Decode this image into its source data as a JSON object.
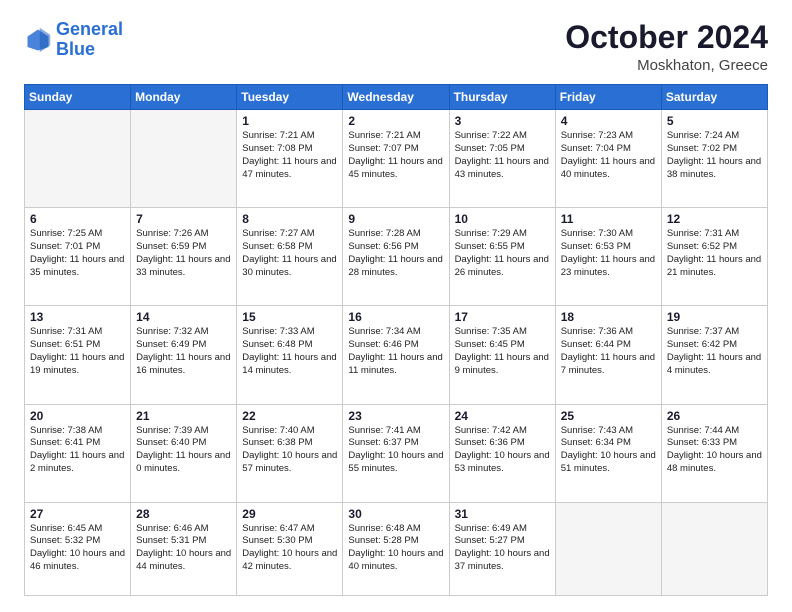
{
  "header": {
    "logo_line1": "General",
    "logo_line2": "Blue",
    "month": "October 2024",
    "location": "Moskhaton, Greece"
  },
  "weekdays": [
    "Sunday",
    "Monday",
    "Tuesday",
    "Wednesday",
    "Thursday",
    "Friday",
    "Saturday"
  ],
  "weeks": [
    [
      {
        "day": "",
        "info": ""
      },
      {
        "day": "",
        "info": ""
      },
      {
        "day": "1",
        "info": "Sunrise: 7:21 AM\nSunset: 7:08 PM\nDaylight: 11 hours and 47 minutes."
      },
      {
        "day": "2",
        "info": "Sunrise: 7:21 AM\nSunset: 7:07 PM\nDaylight: 11 hours and 45 minutes."
      },
      {
        "day": "3",
        "info": "Sunrise: 7:22 AM\nSunset: 7:05 PM\nDaylight: 11 hours and 43 minutes."
      },
      {
        "day": "4",
        "info": "Sunrise: 7:23 AM\nSunset: 7:04 PM\nDaylight: 11 hours and 40 minutes."
      },
      {
        "day": "5",
        "info": "Sunrise: 7:24 AM\nSunset: 7:02 PM\nDaylight: 11 hours and 38 minutes."
      }
    ],
    [
      {
        "day": "6",
        "info": "Sunrise: 7:25 AM\nSunset: 7:01 PM\nDaylight: 11 hours and 35 minutes."
      },
      {
        "day": "7",
        "info": "Sunrise: 7:26 AM\nSunset: 6:59 PM\nDaylight: 11 hours and 33 minutes."
      },
      {
        "day": "8",
        "info": "Sunrise: 7:27 AM\nSunset: 6:58 PM\nDaylight: 11 hours and 30 minutes."
      },
      {
        "day": "9",
        "info": "Sunrise: 7:28 AM\nSunset: 6:56 PM\nDaylight: 11 hours and 28 minutes."
      },
      {
        "day": "10",
        "info": "Sunrise: 7:29 AM\nSunset: 6:55 PM\nDaylight: 11 hours and 26 minutes."
      },
      {
        "day": "11",
        "info": "Sunrise: 7:30 AM\nSunset: 6:53 PM\nDaylight: 11 hours and 23 minutes."
      },
      {
        "day": "12",
        "info": "Sunrise: 7:31 AM\nSunset: 6:52 PM\nDaylight: 11 hours and 21 minutes."
      }
    ],
    [
      {
        "day": "13",
        "info": "Sunrise: 7:31 AM\nSunset: 6:51 PM\nDaylight: 11 hours and 19 minutes."
      },
      {
        "day": "14",
        "info": "Sunrise: 7:32 AM\nSunset: 6:49 PM\nDaylight: 11 hours and 16 minutes."
      },
      {
        "day": "15",
        "info": "Sunrise: 7:33 AM\nSunset: 6:48 PM\nDaylight: 11 hours and 14 minutes."
      },
      {
        "day": "16",
        "info": "Sunrise: 7:34 AM\nSunset: 6:46 PM\nDaylight: 11 hours and 11 minutes."
      },
      {
        "day": "17",
        "info": "Sunrise: 7:35 AM\nSunset: 6:45 PM\nDaylight: 11 hours and 9 minutes."
      },
      {
        "day": "18",
        "info": "Sunrise: 7:36 AM\nSunset: 6:44 PM\nDaylight: 11 hours and 7 minutes."
      },
      {
        "day": "19",
        "info": "Sunrise: 7:37 AM\nSunset: 6:42 PM\nDaylight: 11 hours and 4 minutes."
      }
    ],
    [
      {
        "day": "20",
        "info": "Sunrise: 7:38 AM\nSunset: 6:41 PM\nDaylight: 11 hours and 2 minutes."
      },
      {
        "day": "21",
        "info": "Sunrise: 7:39 AM\nSunset: 6:40 PM\nDaylight: 11 hours and 0 minutes."
      },
      {
        "day": "22",
        "info": "Sunrise: 7:40 AM\nSunset: 6:38 PM\nDaylight: 10 hours and 57 minutes."
      },
      {
        "day": "23",
        "info": "Sunrise: 7:41 AM\nSunset: 6:37 PM\nDaylight: 10 hours and 55 minutes."
      },
      {
        "day": "24",
        "info": "Sunrise: 7:42 AM\nSunset: 6:36 PM\nDaylight: 10 hours and 53 minutes."
      },
      {
        "day": "25",
        "info": "Sunrise: 7:43 AM\nSunset: 6:34 PM\nDaylight: 10 hours and 51 minutes."
      },
      {
        "day": "26",
        "info": "Sunrise: 7:44 AM\nSunset: 6:33 PM\nDaylight: 10 hours and 48 minutes."
      }
    ],
    [
      {
        "day": "27",
        "info": "Sunrise: 6:45 AM\nSunset: 5:32 PM\nDaylight: 10 hours and 46 minutes."
      },
      {
        "day": "28",
        "info": "Sunrise: 6:46 AM\nSunset: 5:31 PM\nDaylight: 10 hours and 44 minutes."
      },
      {
        "day": "29",
        "info": "Sunrise: 6:47 AM\nSunset: 5:30 PM\nDaylight: 10 hours and 42 minutes."
      },
      {
        "day": "30",
        "info": "Sunrise: 6:48 AM\nSunset: 5:28 PM\nDaylight: 10 hours and 40 minutes."
      },
      {
        "day": "31",
        "info": "Sunrise: 6:49 AM\nSunset: 5:27 PM\nDaylight: 10 hours and 37 minutes."
      },
      {
        "day": "",
        "info": ""
      },
      {
        "day": "",
        "info": ""
      }
    ]
  ]
}
